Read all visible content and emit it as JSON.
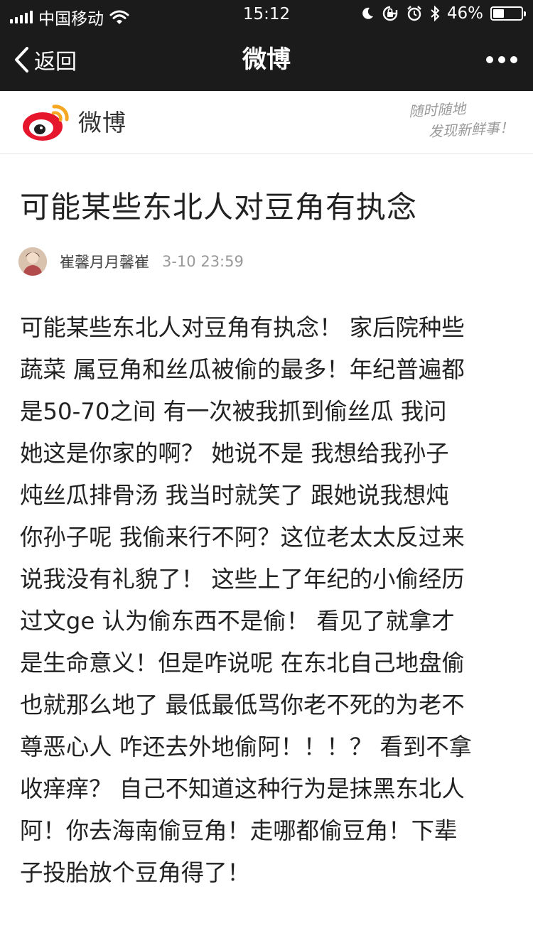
{
  "status_bar": {
    "carrier": "中国移动",
    "time": "15:12",
    "battery": "46%",
    "battery_level": 0.46,
    "icons": [
      "signal-icon",
      "wifi-icon",
      "moon-icon",
      "orientation-lock-icon",
      "alarm-icon",
      "bluetooth-icon",
      "battery-icon"
    ]
  },
  "nav": {
    "back_label": "返回",
    "title": "微博",
    "more_icon": "more-icon"
  },
  "banner": {
    "brand": "微博",
    "slogan_line1": "随时随地",
    "slogan_line2": "发现新鲜事！",
    "logo_color": "#e6162d",
    "accent_color": "#f5a623"
  },
  "article": {
    "title": "可能某些东北人对豆角有执念",
    "author": "崔馨月月馨崔",
    "time": "3-10 23:59",
    "body_lines": [
      "可能某些东北人对豆角有执念！ 家后院种些",
      "蔬菜 属豆角和丝瓜被偷的最多！年纪普遍都",
      "是50-70之间 有一次被我抓到偷丝瓜 我问",
      "她这是你家的啊？ 她说不是 我想给我孙子",
      "炖丝瓜排骨汤 我当时就笑了 跟她说我想炖",
      "你孙子呢 我偷来行不阿？这位老太太反过来",
      "说我没有礼貌了！ 这些上了年纪的小偷经历",
      "过文ge 认为偷东西不是偷！ 看见了就拿才",
      "是生命意义！但是咋说呢 在东北自己地盘偷",
      "也就那么地了 最低最低骂你老不死的为老不",
      "尊恶心人 咋还去外地偷阿！！！？ 看到不拿",
      "收痒痒？ 自己不知道这种行为是抹黑东北人",
      "阿！你去海南偷豆角！走哪都偷豆角！下辈",
      "子投胎放个豆角得了！"
    ]
  }
}
